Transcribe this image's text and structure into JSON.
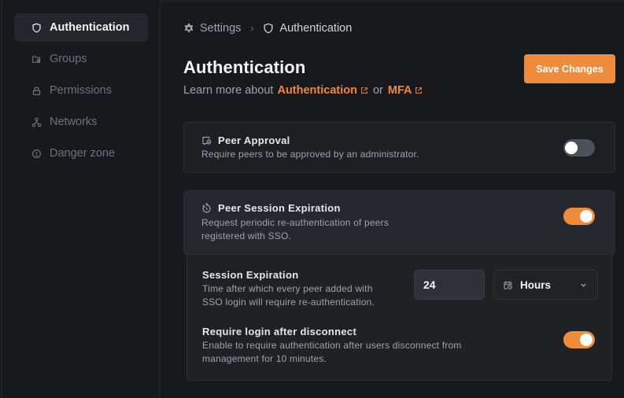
{
  "sidebar": {
    "items": [
      {
        "label": "Authentication",
        "icon": "shield-icon",
        "active": true
      },
      {
        "label": "Groups",
        "icon": "folder-user-icon",
        "active": false
      },
      {
        "label": "Permissions",
        "icon": "lock-icon",
        "active": false
      },
      {
        "label": "Networks",
        "icon": "network-icon",
        "active": false
      },
      {
        "label": "Danger zone",
        "icon": "alert-circle-icon",
        "active": false
      }
    ]
  },
  "breadcrumb": {
    "items": [
      {
        "label": "Settings",
        "icon": "gear-icon"
      },
      {
        "label": "Authentication",
        "icon": "shield-icon"
      }
    ],
    "separator": "›"
  },
  "header": {
    "title": "Authentication",
    "subtitle_lead": "Learn more about",
    "link1": "Authentication",
    "or": "or",
    "link2": "MFA",
    "save_label": "Save Changes"
  },
  "settings": {
    "peer_approval": {
      "title": "Peer Approval",
      "description": "Require peers to be approved by an administrator.",
      "enabled": false
    },
    "peer_session_expiration": {
      "title": "Peer Session Expiration",
      "description_line1": "Request periodic re-authentication of peers",
      "description_line2": "registered with SSO.",
      "enabled": true
    },
    "session_expiration": {
      "title": "Session Expiration",
      "description_line1": "Time after which every peer added with",
      "description_line2": "SSO login will require re-authentication.",
      "value": "24",
      "unit": "Hours"
    },
    "require_login": {
      "title": "Require login after disconnect",
      "description_line1": "Enable to require authentication after users disconnect from",
      "description_line2": "management for 10 minutes.",
      "enabled": true
    }
  },
  "colors": {
    "accent": "#ef8c3c",
    "background": "#18191c",
    "card": "#1e1f23",
    "toggle_off": "#4b5059"
  }
}
